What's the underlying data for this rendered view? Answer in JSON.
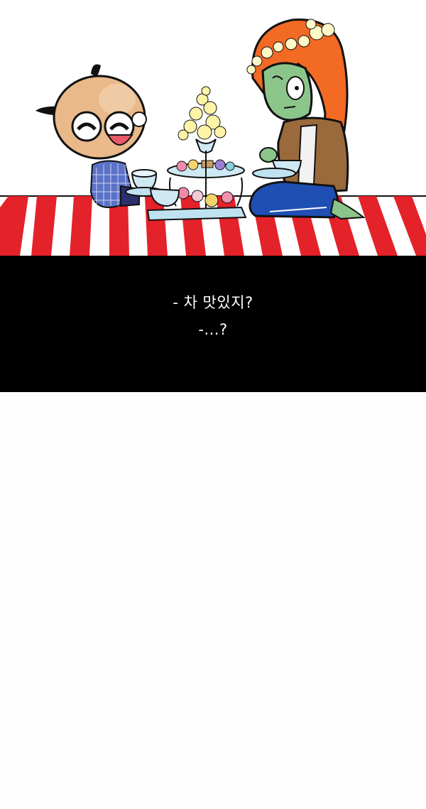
{
  "caption": {
    "line1": "- 차 맛있지?",
    "line2": "-...?"
  },
  "colors": {
    "stripe_red": "#e4222a",
    "band": "#000000",
    "hair": "#f26a24",
    "skin_green": "#8cc58a",
    "face_tan": "#e9b98a"
  }
}
